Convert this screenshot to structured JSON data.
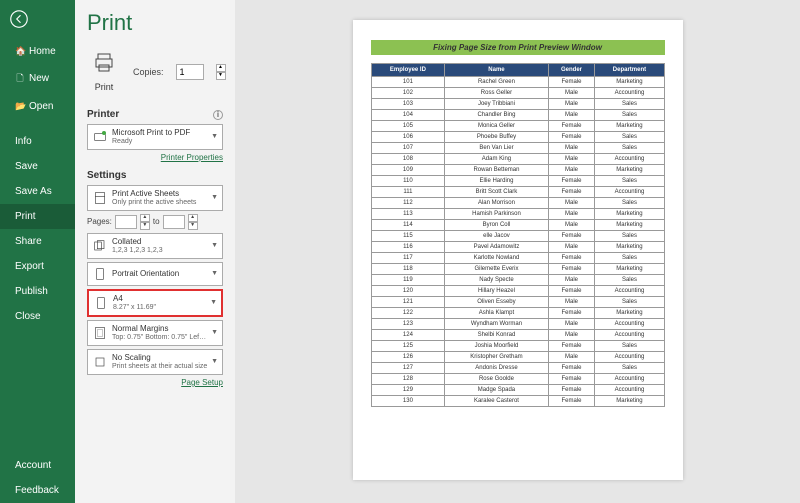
{
  "colors": {
    "accent": "#217346",
    "highlight": "#e03030",
    "tableHeader": "#2a4a7a",
    "pageBar": "#8cc152"
  },
  "page_title": "Print",
  "sidebar": {
    "items": [
      {
        "icon": "🏠",
        "label": "Home"
      },
      {
        "icon": "🗋",
        "label": "New"
      },
      {
        "icon": "📂",
        "label": "Open"
      }
    ],
    "secondary": [
      {
        "label": "Info"
      },
      {
        "label": "Save"
      },
      {
        "label": "Save As"
      },
      {
        "label": "Print",
        "active": true
      },
      {
        "label": "Share"
      },
      {
        "label": "Export"
      },
      {
        "label": "Publish"
      },
      {
        "label": "Close"
      }
    ],
    "footer": [
      {
        "label": "Account"
      },
      {
        "label": "Feedback"
      }
    ]
  },
  "print_button": "Print",
  "copies": {
    "label": "Copies:",
    "value": "1"
  },
  "printer": {
    "header": "Printer",
    "name": "Microsoft Print to PDF",
    "status": "Ready",
    "properties_link": "Printer Properties"
  },
  "settings": {
    "header": "Settings",
    "sheets": {
      "title": "Print Active Sheets",
      "sub": "Only print the active sheets"
    },
    "pages": {
      "label": "Pages:",
      "to": "to"
    },
    "collated": {
      "title": "Collated",
      "sub": "1,2,3  1,2,3  1,2,3"
    },
    "orientation": {
      "title": "Portrait Orientation",
      "sub": ""
    },
    "paper": {
      "title": "A4",
      "sub": "8.27\" x 11.69\""
    },
    "margins": {
      "title": "Normal Margins",
      "sub": "Top: 0.75\" Bottom: 0.75\" Lef…"
    },
    "scaling": {
      "title": "No Scaling",
      "sub": "Print sheets at their actual size"
    },
    "page_setup_link": "Page Setup"
  },
  "preview": {
    "header": "Fixing Page Size from Print Preview Window",
    "columns": [
      "Employee ID",
      "Name",
      "Gender",
      "Department"
    ],
    "rows": [
      [
        "101",
        "Rachel Green",
        "Female",
        "Marketing"
      ],
      [
        "102",
        "Ross Geller",
        "Male",
        "Accounting"
      ],
      [
        "103",
        "Joey Tribbiani",
        "Male",
        "Sales"
      ],
      [
        "104",
        "Chandler Bing",
        "Male",
        "Sales"
      ],
      [
        "105",
        "Monica Geller",
        "Female",
        "Marketing"
      ],
      [
        "106",
        "Phoebe Buffey",
        "Female",
        "Sales"
      ],
      [
        "107",
        "Ben Van Lier",
        "Male",
        "Sales"
      ],
      [
        "108",
        "Adam King",
        "Male",
        "Accounting"
      ],
      [
        "109",
        "Rowan Betteman",
        "Male",
        "Marketing"
      ],
      [
        "110",
        "Ellie Harding",
        "Female",
        "Sales"
      ],
      [
        "111",
        "Britt Scott Clark",
        "Female",
        "Accounting"
      ],
      [
        "112",
        "Alan Morrison",
        "Male",
        "Sales"
      ],
      [
        "113",
        "Hamish Parkinson",
        "Male",
        "Marketing"
      ],
      [
        "114",
        "Byron Coll",
        "Male",
        "Marketing"
      ],
      [
        "115",
        "elle Jacov",
        "Female",
        "Sales"
      ],
      [
        "116",
        "Pavel Adamowitz",
        "Male",
        "Marketing"
      ],
      [
        "117",
        "Karlotte Nowland",
        "Female",
        "Sales"
      ],
      [
        "118",
        "Gilemette Everix",
        "Female",
        "Marketing"
      ],
      [
        "119",
        "Nady Specte",
        "Male",
        "Sales"
      ],
      [
        "120",
        "Hillary Heazel",
        "Female",
        "Accounting"
      ],
      [
        "121",
        "Oliven Esseby",
        "Male",
        "Sales"
      ],
      [
        "122",
        "Ashla Klampt",
        "Female",
        "Marketing"
      ],
      [
        "123",
        "Wyndham Worman",
        "Male",
        "Accounting"
      ],
      [
        "124",
        "Shelbi Konrad",
        "Male",
        "Accounting"
      ],
      [
        "125",
        "Joshia Moorfield",
        "Female",
        "Sales"
      ],
      [
        "126",
        "Kristopher Gretham",
        "Male",
        "Accounting"
      ],
      [
        "127",
        "Andonis Dresse",
        "Female",
        "Sales"
      ],
      [
        "128",
        "Rose Goolde",
        "Female",
        "Accounting"
      ],
      [
        "129",
        "Madge Spada",
        "Female",
        "Accounting"
      ],
      [
        "130",
        "Karalee Casterot",
        "Female",
        "Marketing"
      ]
    ]
  }
}
